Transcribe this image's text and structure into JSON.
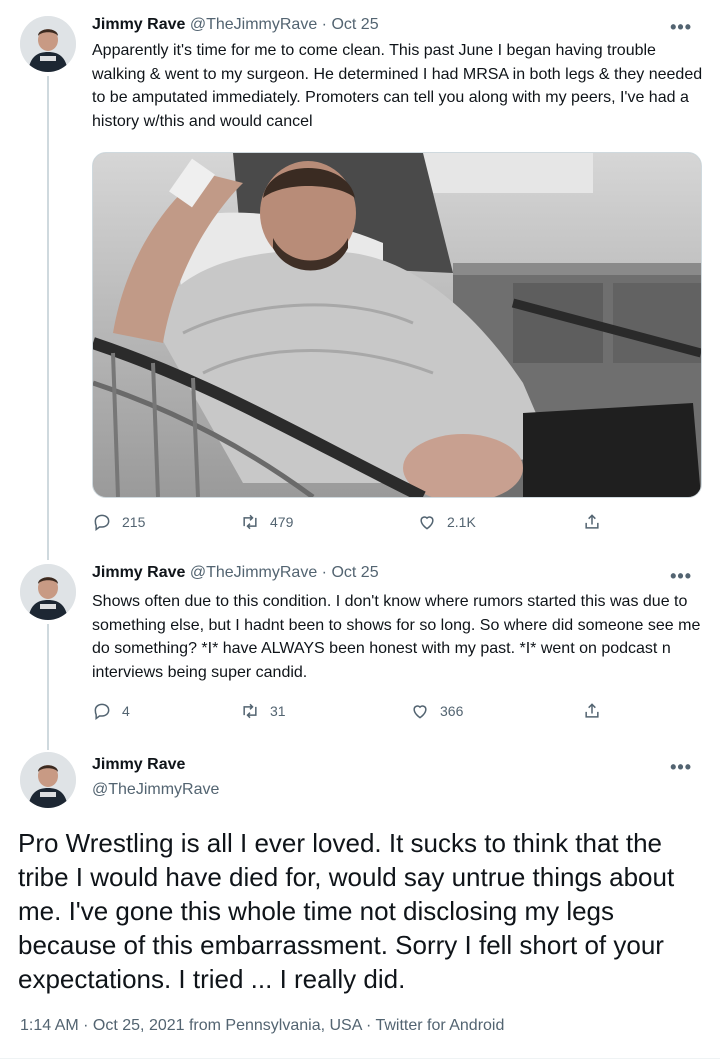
{
  "tweets": [
    {
      "name": "Jimmy Rave",
      "handle": "@TheJimmyRave",
      "separator": "·",
      "date": "Oct 25",
      "text": "Apparently it's time for me to come clean. This past June I began having trouble walking & went to my surgeon. He determined I had MRSA in both legs & they needed to be amputated immediately. Promoters can tell you along with my peers, I've had a history w/this and would cancel",
      "replies": "215",
      "retweets": "479",
      "likes": "2.1K"
    },
    {
      "name": "Jimmy Rave",
      "handle": "@TheJimmyRave",
      "separator": "·",
      "date": "Oct 25",
      "text": "Shows often due to this condition. I don't know where rumors started this was due to something else, but I hadnt  been to shows for so long. So where did someone see me do something? *I* have ALWAYS been honest with my past. *I* went on podcast n interviews being super candid.",
      "replies": "4",
      "retweets": "31",
      "likes": "366"
    }
  ],
  "main_tweet": {
    "name": "Jimmy Rave",
    "handle": "@TheJimmyRave",
    "text": "Pro Wrestling is all I ever loved. It sucks to think that the tribe I would have died for, would say untrue things about me. I've gone this whole time not disclosing my legs because of this embarrassment. Sorry I fell short of your expectations. I tried ... I really did.",
    "meta": "1:14 AM · Oct 25, 2021 from Pennsylvania, USA · Twitter for Android"
  },
  "more_glyph": "•••",
  "colors": {
    "text": "#0f1419",
    "secondary": "#536471",
    "thread_line": "#cfd9de"
  }
}
